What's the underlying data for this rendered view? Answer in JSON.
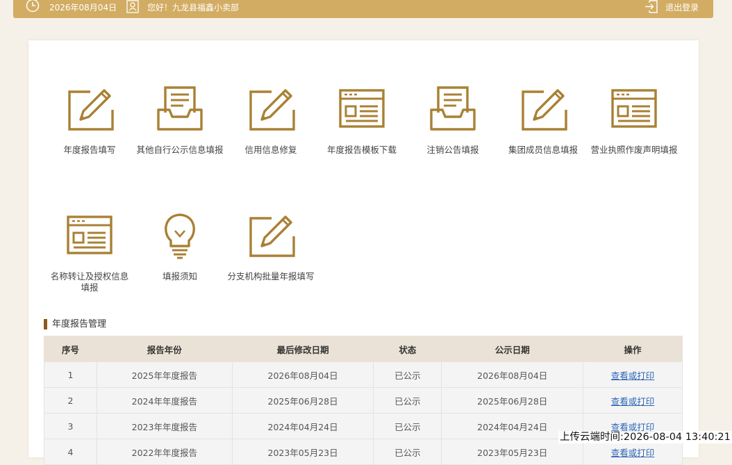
{
  "header": {
    "date": "2026年08月04日",
    "greeting": "您好！九龙县福鑫小卖部",
    "logout_label": "退出登录"
  },
  "colors": {
    "gold": "#a98034",
    "topbar": "#d2ac62",
    "accent": "#8c5a1f"
  },
  "tiles": [
    {
      "label": "年度报告填写",
      "icon": "edit-form-icon"
    },
    {
      "label": "其他自行公示信息填报",
      "icon": "inbox-tray-icon"
    },
    {
      "label": "信用信息修复",
      "icon": "edit-form-icon"
    },
    {
      "label": "年度报告模板下载",
      "icon": "browser-template-icon"
    },
    {
      "label": "注销公告填报",
      "icon": "inbox-tray-icon"
    },
    {
      "label": "集团成员信息填报",
      "icon": "edit-form-icon"
    },
    {
      "label": "营业执照作废声明填报",
      "icon": "browser-template-icon"
    },
    {
      "label": "名称转让及授权信息填报",
      "icon": "browser-template-icon"
    },
    {
      "label": "填报须知",
      "icon": "lightbulb-icon"
    },
    {
      "label": "分支机构批量年报填写",
      "icon": "edit-form-icon"
    }
  ],
  "section_title": "年度报告管理",
  "table": {
    "headers": [
      "序号",
      "报告年份",
      "最后修改日期",
      "状态",
      "公示日期",
      "操作"
    ],
    "rows": [
      [
        "1",
        "2025年年度报告",
        "2026年08月04日",
        "已公示",
        "2026年08月04日",
        "查看或打印"
      ],
      [
        "2",
        "2024年年度报告",
        "2025年06月28日",
        "已公示",
        "2025年06月28日",
        "查看或打印"
      ],
      [
        "3",
        "2023年年度报告",
        "2024年04月24日",
        "已公示",
        "2024年04月24日",
        "查看或打印"
      ],
      [
        "4",
        "2022年年度报告",
        "2023年05月23日",
        "已公示",
        "2023年05月23日",
        "查看或打印"
      ]
    ]
  },
  "upload_stamp": "上传云端时间:2026-08-04 13:40:21"
}
